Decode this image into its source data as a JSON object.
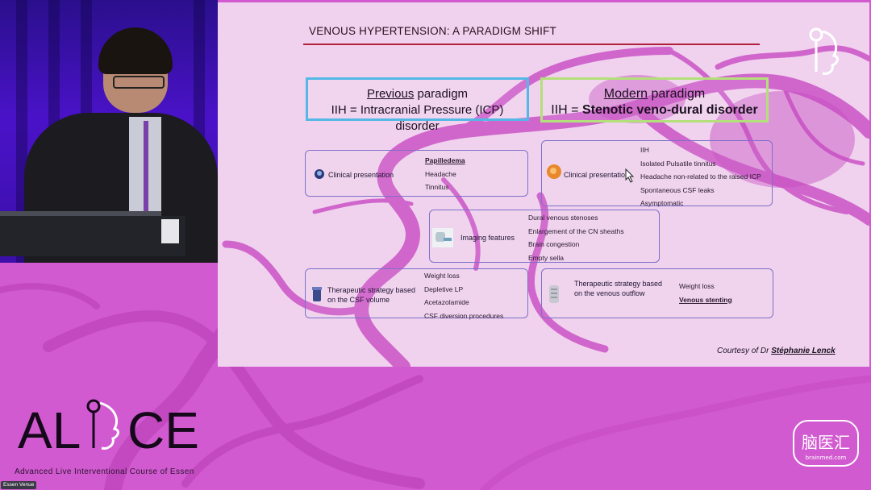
{
  "slide": {
    "title": "VENOUS HYPERTENSION: A PARADIGM SHIFT",
    "previous": {
      "heading_underlined": "Previous",
      "heading_rest": " paradigm",
      "line": "IIH = Intracranial Pressure (ICP) disorder",
      "border_color": "#54b8e6"
    },
    "modern": {
      "heading_underlined": "Modern",
      "heading_rest": " paradigm",
      "line_prefix": "IIH = ",
      "line_bold": "Stenotic veno-dural disorder",
      "border_color": "#b3e07a"
    },
    "clinical_prev": {
      "label": "Clinical presentation",
      "icon": "head-brain-icon",
      "items": [
        "Papilledema",
        "Headache",
        "Tinnitus"
      ]
    },
    "clinical_modern": {
      "label": "Clinical presentation",
      "icon": "head-brain-orange-icon",
      "items": [
        "IIH",
        "Isolated Pulsatile tinnitus",
        "Headache non-related to the raised ICP",
        "Spontaneous CSF leaks",
        "Asymptomatic"
      ]
    },
    "imaging": {
      "label": "Imaging features",
      "icon": "mri-scanner-icon",
      "items": [
        "Dural venous stenoses",
        "Enlargement of the CN sheaths",
        "Brain congestion",
        "Empty sella"
      ]
    },
    "thera_prev": {
      "label": "Therapeutic strategy based on the CSF volume",
      "icon": "medication-icon",
      "items": [
        "Weight loss",
        "Depletive LP",
        "Acetazolamide",
        "CSF diversion procedures"
      ]
    },
    "thera_modern": {
      "label": "Therapeutic strategy based on the venous outflow",
      "icon": "stent-icon",
      "items": [
        "Weight loss",
        "Venous stenting"
      ]
    },
    "courtesy_prefix": "Courtesy of Dr ",
    "courtesy_name": "Stéphanie Lenck"
  },
  "branding": {
    "logo_text_left": "AL",
    "logo_text_right": "CE",
    "subtitle": "Advanced Live Interventional Course of Essen",
    "watermark_text": "脑医汇",
    "watermark_sub": "brainmed.com",
    "venue_tag": "Essen Venue"
  },
  "colors": {
    "background": "#d25ad0",
    "slide_background": "#f0d2ee",
    "title_rule": "#b0203a",
    "box_border": "#7c70c8"
  }
}
